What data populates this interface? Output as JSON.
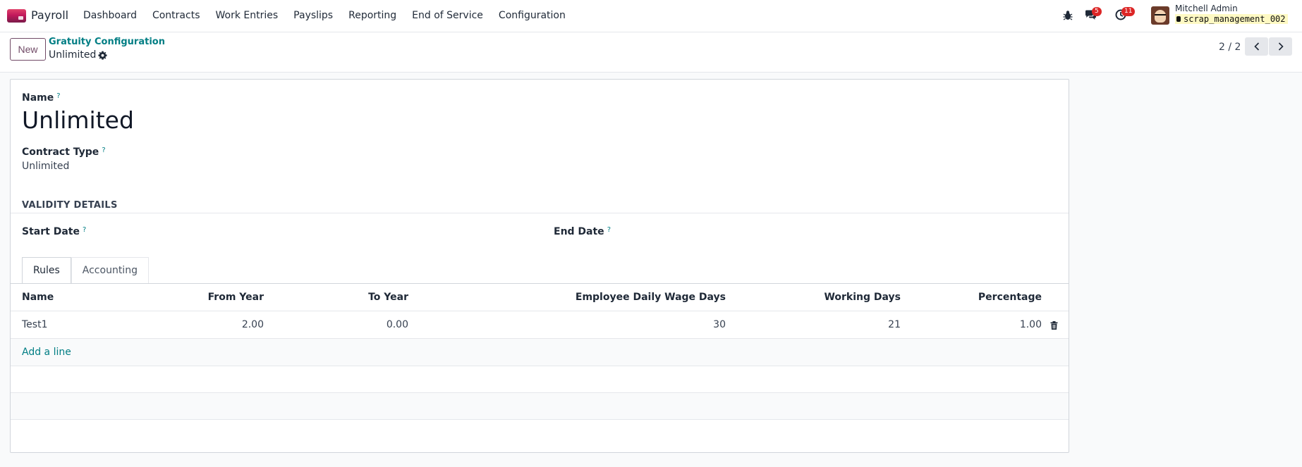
{
  "navbar": {
    "app_name": "Payroll",
    "menu": [
      "Dashboard",
      "Contracts",
      "Work Entries",
      "Payslips",
      "Reporting",
      "End of Service",
      "Configuration"
    ],
    "chat_count": "5",
    "activity_count": "11",
    "user_name": "Mitchell Admin",
    "database": "scrap_management_002",
    "brand_color": "#714b67",
    "badge_color": "#dc2626"
  },
  "control": {
    "new_label": "New",
    "breadcrumb": "Gratuity Configuration",
    "record_name": "Unlimited",
    "pager": "2 / 2"
  },
  "form": {
    "name_label": "Name",
    "name_value": "Unlimited",
    "contract_type_label": "Contract Type",
    "contract_type_value": "Unlimited",
    "section_title": "VALIDITY DETAILS",
    "start_date_label": "Start Date",
    "end_date_label": "End Date",
    "help_mark": "?",
    "tabs": [
      "Rules",
      "Accounting"
    ],
    "active_tab": "Rules",
    "columns": [
      "Name",
      "From Year",
      "To Year",
      "Employee Daily Wage Days",
      "Working Days",
      "Percentage"
    ],
    "rows": [
      {
        "name": "Test1",
        "from_year": "2.00",
        "to_year": "0.00",
        "daily_wage_days": "30",
        "working_days": "21",
        "percentage": "1.00"
      }
    ],
    "add_line": "Add a line",
    "link_color": "#017e84"
  }
}
